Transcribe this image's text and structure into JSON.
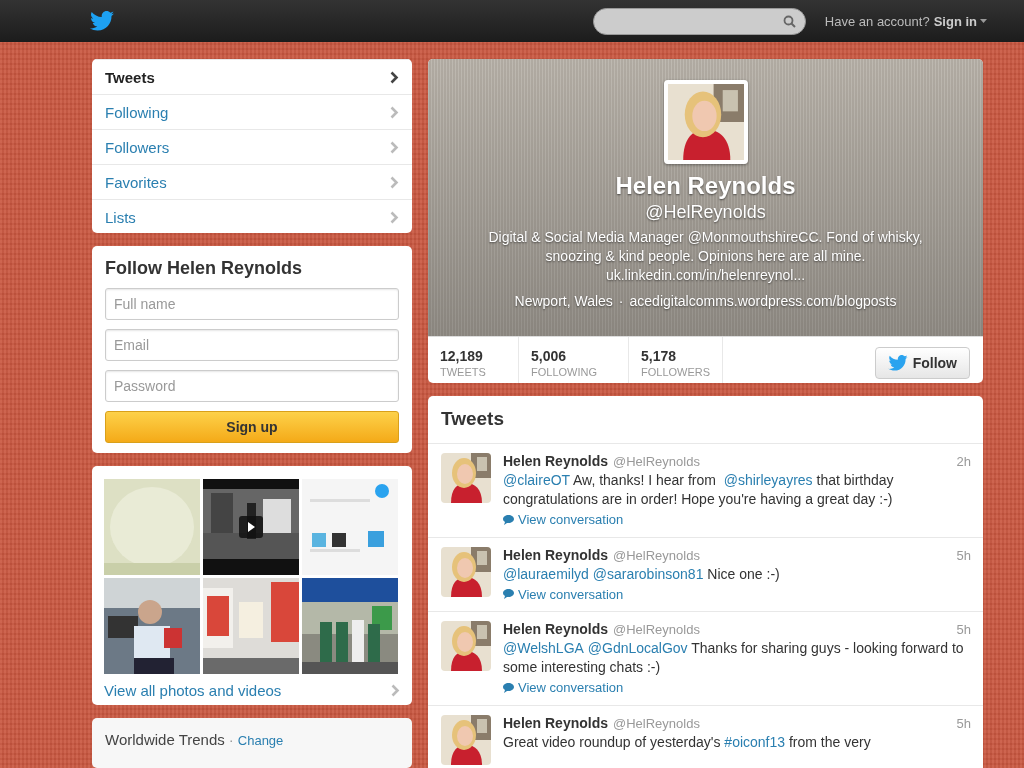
{
  "top_bar": {
    "account_prompt": "Have an account?",
    "sign_in": "Sign in"
  },
  "nav": [
    {
      "label": "Tweets",
      "selected": true
    },
    {
      "label": "Following",
      "selected": false
    },
    {
      "label": "Followers",
      "selected": false
    },
    {
      "label": "Favorites",
      "selected": false
    },
    {
      "label": "Lists",
      "selected": false
    }
  ],
  "follow_form": {
    "title": "Follow Helen Reynolds",
    "fields": [
      {
        "placeholder": "Full name"
      },
      {
        "placeholder": "Email"
      },
      {
        "placeholder": "Password"
      }
    ],
    "button": "Sign up"
  },
  "media": {
    "thumbnails": [
      {
        "kind": "picture"
      },
      {
        "kind": "video"
      },
      {
        "kind": "picture"
      },
      {
        "kind": "picture"
      },
      {
        "kind": "picture"
      },
      {
        "kind": "picture"
      }
    ],
    "link": "View all photos and videos"
  },
  "trends": {
    "title": "Worldwide Trends",
    "separator": "·",
    "change": "Change"
  },
  "profile": {
    "name": "Helen Reynolds",
    "handle": "@HelReynolds",
    "bio": "Digital & Social Media Manager @MonmouthshireCC. Fond of whisky, snoozing & kind people. Opinions here are all mine. uk.linkedin.com/in/helenreynol...",
    "location": "Newport, Wales",
    "separator": "·",
    "url": "acedigitalcomms.wordpress.com/blogposts",
    "stats": [
      {
        "value": "12,189",
        "label": "TWEETS"
      },
      {
        "value": "5,006",
        "label": "FOLLOWING"
      },
      {
        "value": "5,178",
        "label": "FOLLOWERS"
      }
    ],
    "follow_button": "Follow"
  },
  "tweets": {
    "title": "Tweets",
    "items": [
      {
        "name": "Helen Reynolds",
        "handle": "@HelReynolds",
        "time": "2h",
        "text": [
          {
            "kind": "link",
            "text": "@claireOT"
          },
          {
            "kind": "plain",
            "text": " Aw, thanks! I hear from "
          },
          {
            "kind": "link",
            "text": "@shirleyayres"
          },
          {
            "kind": "plain",
            "text": " that birthday congratulations are in order!  Hope you're having a great day :-)"
          }
        ],
        "view_conversation": "View conversation"
      },
      {
        "name": "Helen Reynolds",
        "handle": "@HelReynolds",
        "time": "5h",
        "text": [
          {
            "kind": "link",
            "text": "@lauraemilyd"
          },
          {
            "kind": "link",
            "text": "@sararobinson81"
          },
          {
            "kind": "plain",
            "text": " Nice one :-)"
          }
        ],
        "view_conversation": "View conversation"
      },
      {
        "name": "Helen Reynolds",
        "handle": "@HelReynolds",
        "time": "5h",
        "text": [
          {
            "kind": "link",
            "text": "@WelshLGA"
          },
          {
            "kind": "link",
            "text": "@GdnLocalGov"
          },
          {
            "kind": "plain",
            "text": " Thanks for sharing guys - looking forward to some interesting chats :-)"
          }
        ],
        "view_conversation": "View conversation"
      },
      {
        "name": "Helen Reynolds",
        "handle": "@HelReynolds",
        "time": "5h",
        "text": [
          {
            "kind": "plain",
            "text": "Great video roundup of yesterday's "
          },
          {
            "kind": "link",
            "text": "#oiconf13"
          },
          {
            "kind": "plain",
            "text": " from the very"
          }
        ]
      }
    ]
  }
}
